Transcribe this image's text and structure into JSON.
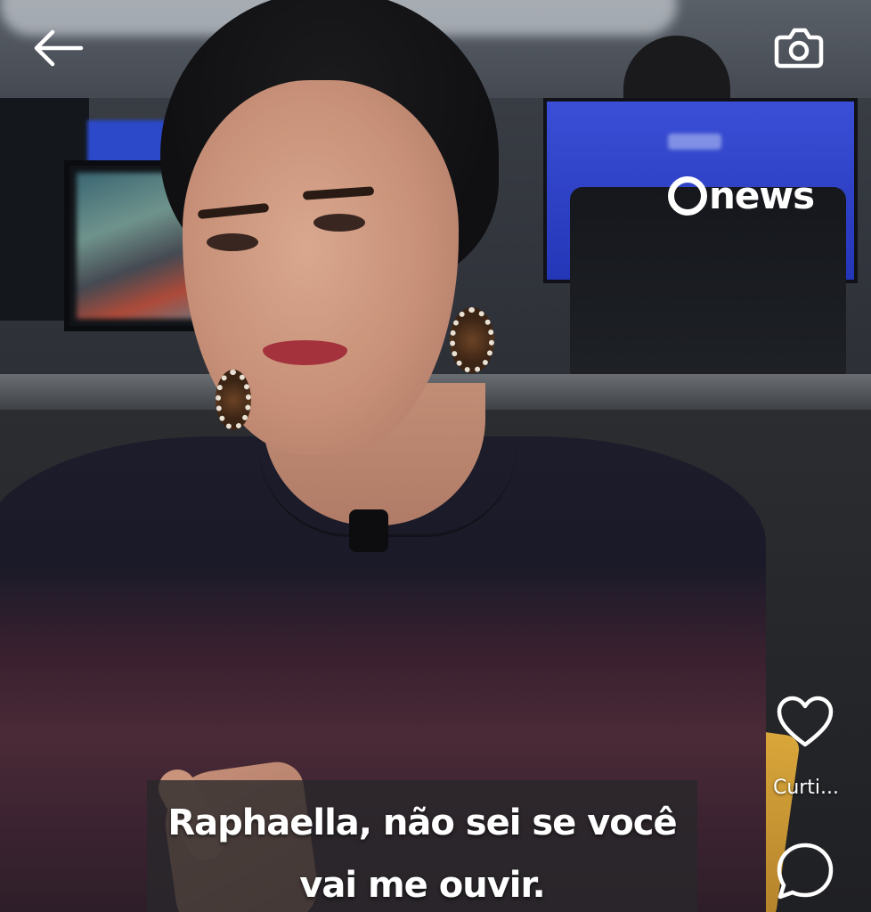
{
  "overlay": {
    "back_icon": "arrow-left-icon",
    "camera_icon": "camera-icon",
    "like_icon": "heart-icon",
    "like_label": "Curti...",
    "comment_icon": "comment-bubble-icon"
  },
  "video": {
    "channel_logo_text": "news",
    "caption_lines": [
      "Raphaella, não sei se você",
      "vai me ouvir."
    ]
  },
  "colors": {
    "overlay_icon": "#ffffff",
    "caption_background": "#28282a",
    "caption_text": "#ffffff"
  }
}
